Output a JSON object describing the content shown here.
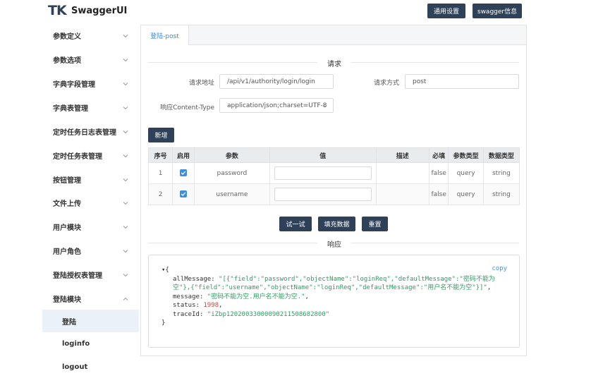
{
  "header": {
    "logo": "TK",
    "brand": "SwaggerUI",
    "btn_settings": "通用设置",
    "btn_info": "swagger信息"
  },
  "sidebar": {
    "items": [
      {
        "label": "参数定义"
      },
      {
        "label": "参数选项"
      },
      {
        "label": "字典字段管理"
      },
      {
        "label": "字典表管理"
      },
      {
        "label": "定时任务日志表管理"
      },
      {
        "label": "定时任务表管理"
      },
      {
        "label": "按钮管理"
      },
      {
        "label": "文件上传"
      },
      {
        "label": "用户模块"
      },
      {
        "label": "用户角色"
      },
      {
        "label": "登陆授权表管理"
      },
      {
        "label": "登陆模块"
      }
    ],
    "subitems": [
      {
        "label": "登陆",
        "active": true
      },
      {
        "label": "loginfo"
      },
      {
        "label": "logout"
      }
    ]
  },
  "tab": {
    "label": "登陆-post"
  },
  "request": {
    "section_title": "请求",
    "url_label": "请求地址",
    "url_value": "/api/v1/authority/login/login",
    "method_label": "请求方式",
    "method_value": "post",
    "content_type_label": "响应Content-Type",
    "content_type_value": "application/json;charset=UTF-8",
    "add_button": "新增"
  },
  "params_table": {
    "headers": [
      "序号",
      "启用",
      "参数",
      "值",
      "描述",
      "必填",
      "参数类型",
      "数据类型"
    ],
    "rows": [
      {
        "index": "1",
        "name": "password",
        "required": "false",
        "param_type": "query",
        "data_type": "string"
      },
      {
        "index": "2",
        "name": "username",
        "required": "false",
        "param_type": "query",
        "data_type": "string"
      }
    ]
  },
  "actions": {
    "try": "试一试",
    "fill": "填充数据",
    "reset": "重置"
  },
  "response": {
    "section_title": "响应",
    "copy": "copy",
    "toggle": "▾",
    "open_brace": "{",
    "close_brace": "}",
    "allMessage_key": "allMessage",
    "allMessage_value": "\"[{\"field\":\"password\",\"objectName\":\"loginReq\",\"defaultMessage\":\"密码不能为空\"},{\"field\":\"username\",\"objectName\":\"loginReq\",\"defaultMessage\":\"用户名不能为空\"}]\"",
    "message_key": "message",
    "message_value": "\"密码不能为空.用户名不能为空.\"",
    "status_key": "status",
    "status_value": "1998",
    "traceId_key": "traceId",
    "traceId_value": "\"iZbp12020033000090211508682800\""
  }
}
